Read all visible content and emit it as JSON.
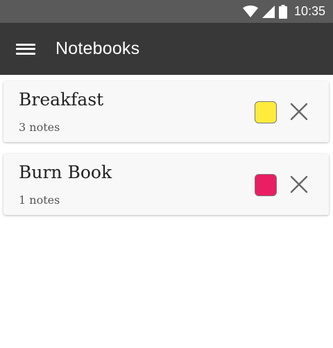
{
  "status": {
    "time": "10:35"
  },
  "app_bar": {
    "title": "Notebooks"
  },
  "notebooks": [
    {
      "name": "Breakfast",
      "count_label": "3 notes",
      "color": "#ffeb3b"
    },
    {
      "name": "Burn Book",
      "count_label": "1 notes",
      "color": "#e91e63"
    }
  ],
  "colors": {
    "status_bar": "#5a5a5a",
    "app_bar": "#383838",
    "card_bg": "#f8f8f8"
  }
}
